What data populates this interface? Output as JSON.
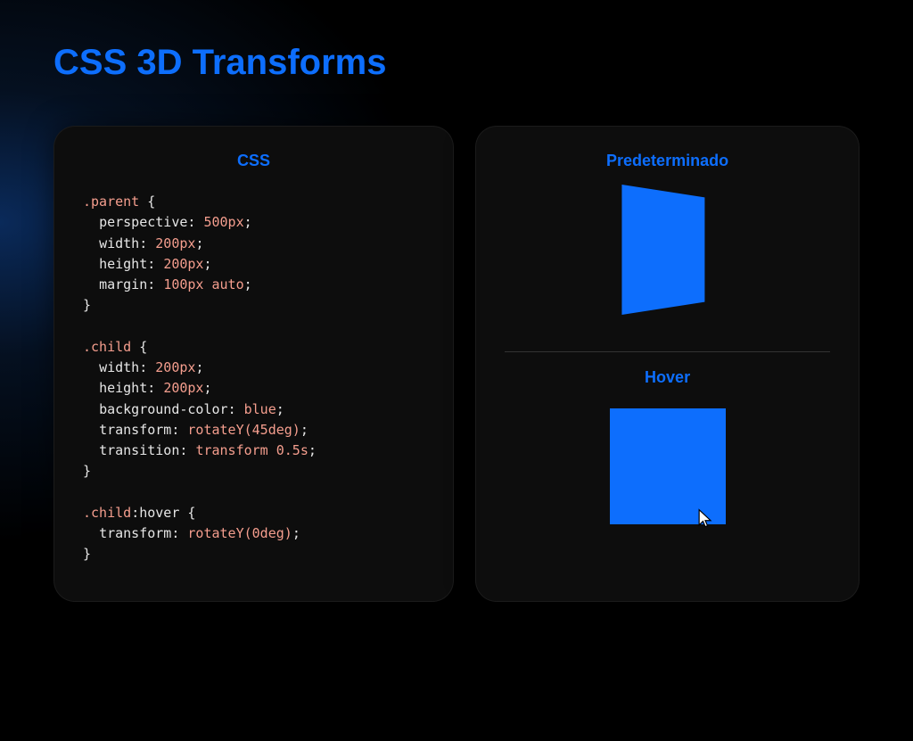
{
  "page": {
    "title": "CSS 3D Transforms"
  },
  "codePanel": {
    "heading": "CSS",
    "rules": [
      {
        "selector": ".parent",
        "selector_suffix": " ",
        "decls": [
          {
            "prop": "perspective",
            "val": "500px"
          },
          {
            "prop": "width",
            "val": "200px"
          },
          {
            "prop": "height",
            "val": "200px"
          },
          {
            "prop": "margin",
            "val": "100px auto"
          }
        ]
      },
      {
        "selector": ".child",
        "selector_suffix": " ",
        "decls": [
          {
            "prop": "width",
            "val": "200px"
          },
          {
            "prop": "height",
            "val": "200px"
          },
          {
            "prop": "background-color",
            "val": "blue"
          },
          {
            "prop": "transform",
            "val": "rotateY(45deg)"
          },
          {
            "prop": "transition",
            "val": "transform 0.5s"
          }
        ]
      },
      {
        "selector": ".child",
        "selector_suffix": ":hover ",
        "decls": [
          {
            "prop": "transform",
            "val": "rotateY(0deg)"
          }
        ]
      }
    ]
  },
  "demoPanel": {
    "defaultHeading": "Predeterminado",
    "hoverHeading": "Hover"
  },
  "colors": {
    "accent": "#0d6efd",
    "panel": "#0d0d0d"
  }
}
